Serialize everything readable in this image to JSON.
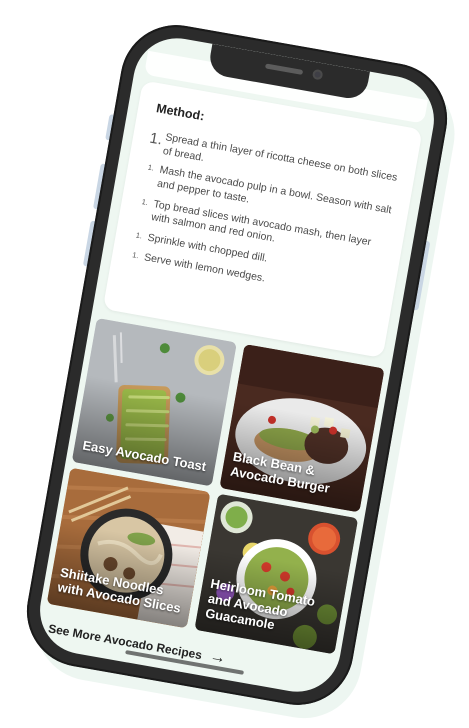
{
  "method": {
    "title": "Method:",
    "steps": [
      {
        "num": "1.",
        "text": "Spread a thin layer of ricotta cheese on both slices of bread."
      },
      {
        "num": "1.",
        "text": "Mash the avocado pulp in a bowl. Season with salt and pepper to taste."
      },
      {
        "num": "1.",
        "text": "Top bread slices with avocado mash, then layer with salmon and red onion."
      },
      {
        "num": "1.",
        "text": "Sprinkle with chopped dill."
      },
      {
        "num": "1.",
        "text": "Serve with lemon wedges."
      }
    ]
  },
  "recipes": [
    {
      "label": "Easy Avocado Toast"
    },
    {
      "label": "Black Bean & Avocado Burger"
    },
    {
      "label": "Shiitake Noodles with Avocado Slices"
    },
    {
      "label": "Heirloom Tomato and Avocado Guacamole"
    }
  ],
  "see_more": {
    "label": "See More Avocado Recipes",
    "arrow_icon": "arrow-right-icon"
  },
  "colors": {
    "frame": "#2b2b2b",
    "screen_bg": "#eef7f1",
    "card_bg": "#ffffff",
    "side_buttons": "#c9d6e4"
  }
}
